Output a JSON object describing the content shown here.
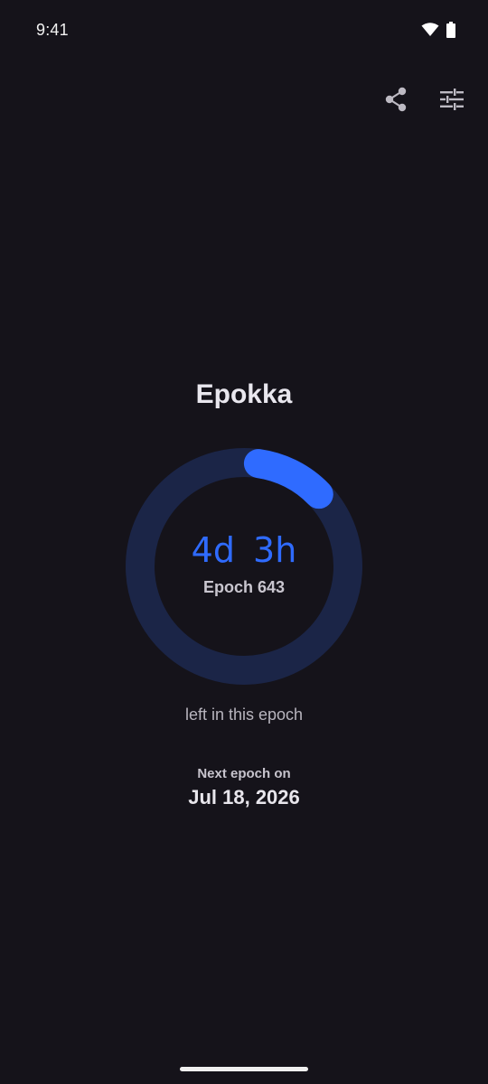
{
  "status_bar": {
    "time": "9:41",
    "icons": [
      "wifi-icon",
      "battery-icon"
    ]
  },
  "toolbar": {
    "actions": [
      "share-icon",
      "tune-icon"
    ]
  },
  "app": {
    "title": "Epokka"
  },
  "epoch": {
    "time_left": "4d 3h",
    "label": "Epoch 643",
    "left_caption": "left in this epoch",
    "progress_remaining_fraction": 0.15,
    "next_caption": "Next epoch on",
    "next_date": "Jul 18, 2026"
  },
  "colors": {
    "background": "#15131a",
    "accent": "#2f6bff",
    "ring_track": "#1b2547"
  }
}
